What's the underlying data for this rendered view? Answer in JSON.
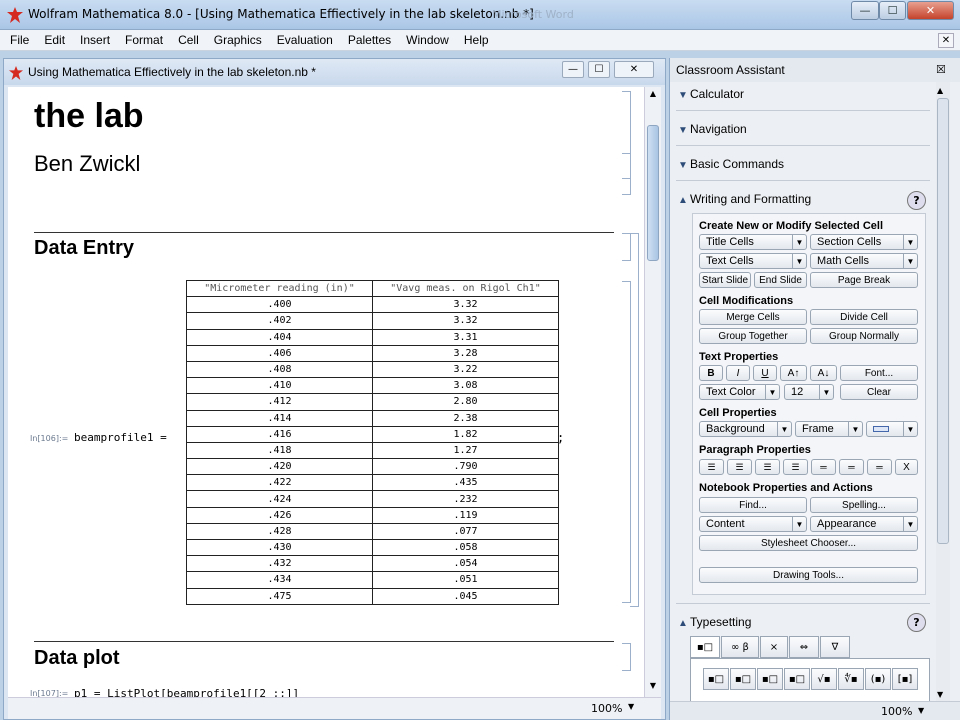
{
  "window": {
    "title": "Wolfram Mathematica 8.0 - [Using Mathematica Effiectively in the lab skeleton.nb *]",
    "ghost_text": "Microsoft Word",
    "min": "—",
    "max": "☐",
    "close": "✕"
  },
  "menu": [
    {
      "label": "File"
    },
    {
      "label": "Edit"
    },
    {
      "label": "Insert"
    },
    {
      "label": "Format"
    },
    {
      "label": "Cell"
    },
    {
      "label": "Graphics"
    },
    {
      "label": "Evaluation"
    },
    {
      "label": "Palettes"
    },
    {
      "label": "Window"
    },
    {
      "label": "Help"
    }
  ],
  "notebook": {
    "title": "Using Mathematica Effiectively in the lab skeleton.nb *",
    "doc_title": "the lab",
    "author": "Ben Zwickl",
    "section1": "Data Entry",
    "input_label": "In[106]:=",
    "input_text": "beamprofile1 =",
    "semicolon": ";",
    "section2": "Data plot",
    "partial_label": "In[107]:=",
    "partial_code": "p1 = ListPlot[beamprofile1[[2 ;;]]",
    "zoom": "100%",
    "table": {
      "headers": [
        "\"Micrometer reading (in)\"",
        "\"Vavg meas. on Rigol Ch1\""
      ],
      "rows": [
        [
          ".400",
          "3.32"
        ],
        [
          ".402",
          "3.32"
        ],
        [
          ".404",
          "3.31"
        ],
        [
          ".406",
          "3.28"
        ],
        [
          ".408",
          "3.22"
        ],
        [
          ".410",
          "3.08"
        ],
        [
          ".412",
          "2.80"
        ],
        [
          ".414",
          "2.38"
        ],
        [
          ".416",
          "1.82"
        ],
        [
          ".418",
          "1.27"
        ],
        [
          ".420",
          ".790"
        ],
        [
          ".422",
          ".435"
        ],
        [
          ".424",
          ".232"
        ],
        [
          ".426",
          ".119"
        ],
        [
          ".428",
          ".077"
        ],
        [
          ".430",
          ".058"
        ],
        [
          ".432",
          ".054"
        ],
        [
          ".434",
          ".051"
        ],
        [
          ".475",
          ".045"
        ]
      ]
    }
  },
  "palette": {
    "title": "Classroom Assistant",
    "close": "☒",
    "sections": {
      "calculator": "Calculator",
      "navigation": "Navigation",
      "basic": "Basic Commands",
      "writing": "Writing and Formatting",
      "typesetting": "Typesetting"
    },
    "help": "?",
    "create_head": "Create New or Modify Selected Cell",
    "title_cells": "Title Cells",
    "section_cells": "Section Cells",
    "text_cells": "Text Cells",
    "math_cells": "Math Cells",
    "start_slide": "Start Slide",
    "end_slide": "End Slide",
    "page_break": "Page Break",
    "mods_head": "Cell Modifications",
    "merge": "Merge Cells",
    "divide": "Divide Cell",
    "group_together": "Group Together",
    "group_normally": "Group Normally",
    "text_props_head": "Text Properties",
    "bold": "B",
    "italic": "I",
    "underline": "U",
    "bigger": "A↑",
    "smaller": "A↓",
    "font": "Font...",
    "text_color": "Text Color",
    "size": "12",
    "clear": "Clear",
    "cell_props_head": "Cell Properties",
    "background": "Background",
    "frame": "Frame",
    "para_head": "Paragraph Properties",
    "para_x": "X",
    "nb_head": "Notebook Properties and Actions",
    "find": "Find...",
    "spelling": "Spelling...",
    "content": "Content",
    "appearance": "Appearance",
    "stylesheet": "Stylesheet Chooser...",
    "drawing": "Drawing Tools...",
    "ts_tabs": [
      "▪□",
      "∞ β",
      "×",
      "⇔",
      "∇"
    ],
    "ts_buttons": [
      "▪□",
      "▪□",
      "▪□",
      "▪□",
      "√▪",
      "∜▪",
      "(▪)",
      "[▪]"
    ],
    "zoom": "100%"
  }
}
